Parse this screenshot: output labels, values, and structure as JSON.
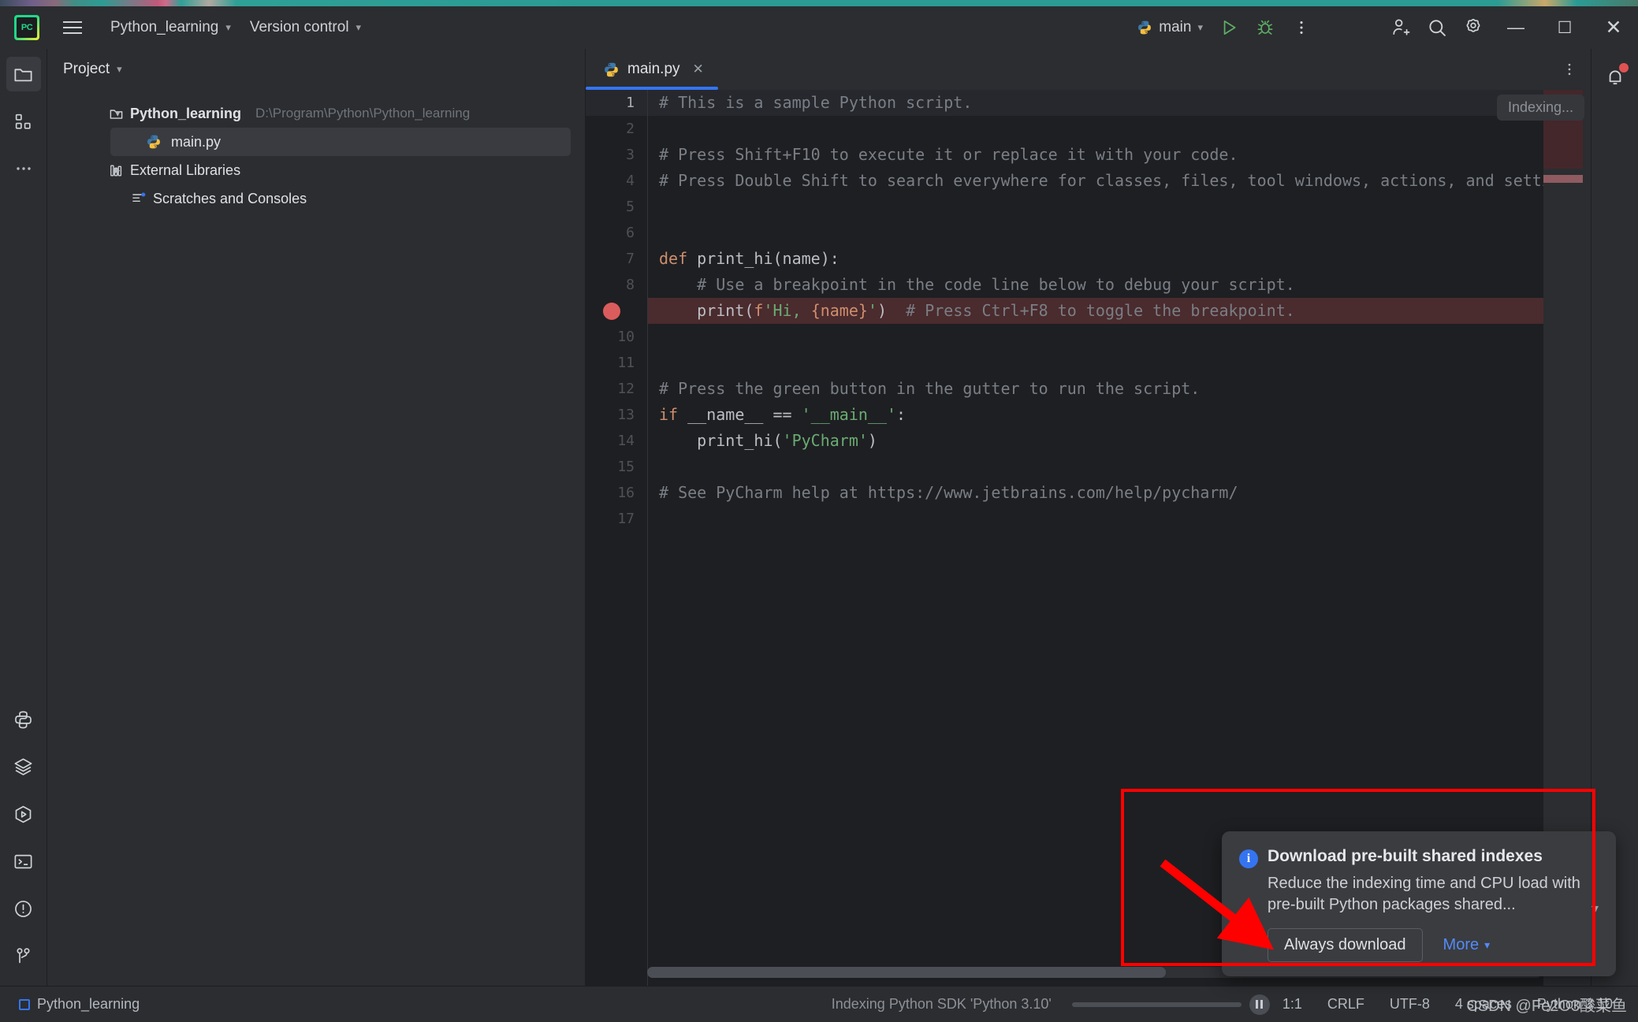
{
  "titlebar": {
    "logo": "pycharm-logo",
    "project_menu": "Python_learning",
    "vcs_menu": "Version control",
    "run_config": "main",
    "icons": [
      "run-icon",
      "debug-icon",
      "more-actions-icon",
      "add-user-icon",
      "search-icon",
      "settings-icon"
    ],
    "window": {
      "minimize": "—",
      "maximize": "☐",
      "close": "✕"
    }
  },
  "leftbar": {
    "top_items": [
      {
        "name": "project-tool-window",
        "icon": "folder-icon",
        "active": true
      },
      {
        "name": "structure-tool-window",
        "icon": "structure-icon",
        "active": false
      },
      {
        "name": "more-tool-windows",
        "icon": "ellipsis-icon",
        "active": false
      }
    ],
    "bottom_items": [
      {
        "name": "python-console",
        "icon": "python-icon"
      },
      {
        "name": "database",
        "icon": "layers-icon"
      },
      {
        "name": "run-tool-window",
        "icon": "run-hex-icon"
      },
      {
        "name": "terminal",
        "icon": "terminal-icon"
      },
      {
        "name": "problems",
        "icon": "warning-circle-icon"
      },
      {
        "name": "version-control",
        "icon": "git-branch-icon"
      }
    ]
  },
  "project": {
    "title": "Project",
    "tree": [
      {
        "label": "Python_learning",
        "path": "D:\\Program\\Python\\Python_learning",
        "icon": "folder-icon",
        "expanded": true,
        "level": 1,
        "selected": false
      },
      {
        "label": "main.py",
        "path": "",
        "icon": "python-file-icon",
        "expanded": null,
        "level": 2,
        "selected": true
      },
      {
        "label": "External Libraries",
        "path": "",
        "icon": "library-icon",
        "expanded": false,
        "level": 1,
        "selected": false
      },
      {
        "label": "Scratches and Consoles",
        "path": "",
        "icon": "scratches-icon",
        "expanded": null,
        "level": 1,
        "selected": false
      }
    ]
  },
  "editor": {
    "tab": {
      "label": "main.py",
      "icon": "python-file-icon",
      "close": "✕"
    },
    "options_icon": "more-vertical-icon",
    "indexing_badge": "Indexing...",
    "breakpoint_line": 9,
    "lines": [
      {
        "n": 1,
        "tokens": [
          {
            "t": "# This is a sample Python script.",
            "c": "cmt"
          }
        ]
      },
      {
        "n": 2,
        "tokens": []
      },
      {
        "n": 3,
        "tokens": [
          {
            "t": "# Press Shift+F10 to execute it or replace it with your code.",
            "c": "cmt"
          }
        ]
      },
      {
        "n": 4,
        "tokens": [
          {
            "t": "# Press Double Shift to search everywhere for classes, files, tool windows, actions, and settings.",
            "c": "cmt"
          }
        ]
      },
      {
        "n": 5,
        "tokens": []
      },
      {
        "n": 6,
        "tokens": []
      },
      {
        "n": 7,
        "tokens": [
          {
            "t": "def ",
            "c": "kw"
          },
          {
            "t": "print_hi(name):",
            "c": "fn"
          }
        ]
      },
      {
        "n": 8,
        "tokens": [
          {
            "t": "    # Use a breakpoint in the code line below to debug your script.",
            "c": "cmt"
          }
        ]
      },
      {
        "n": 9,
        "tokens": [
          {
            "t": "    print(",
            "c": "fn"
          },
          {
            "t": "f",
            "c": "fprefix"
          },
          {
            "t": "'Hi, ",
            "c": "str"
          },
          {
            "t": "{name}",
            "c": "brace"
          },
          {
            "t": "'",
            "c": "str"
          },
          {
            "t": ")  ",
            "c": "fn"
          },
          {
            "t": "# Press Ctrl+F8 to toggle the breakpoint.",
            "c": "cmt"
          }
        ]
      },
      {
        "n": 10,
        "tokens": []
      },
      {
        "n": 11,
        "tokens": []
      },
      {
        "n": 12,
        "tokens": [
          {
            "t": "# Press the green button in the gutter to run the script.",
            "c": "cmt"
          }
        ]
      },
      {
        "n": 13,
        "tokens": [
          {
            "t": "if ",
            "c": "kw"
          },
          {
            "t": "__name__ == ",
            "c": "fn"
          },
          {
            "t": "'__main__'",
            "c": "str"
          },
          {
            "t": ":",
            "c": "fn"
          }
        ]
      },
      {
        "n": 14,
        "tokens": [
          {
            "t": "    print_hi(",
            "c": "fn"
          },
          {
            "t": "'PyCharm'",
            "c": "str"
          },
          {
            "t": ")",
            "c": "fn"
          }
        ]
      },
      {
        "n": 15,
        "tokens": []
      },
      {
        "n": 16,
        "tokens": [
          {
            "t": "# See PyCharm help at https://www.jetbrains.com/help/pycharm/",
            "c": "cmt"
          }
        ]
      },
      {
        "n": 17,
        "tokens": []
      }
    ]
  },
  "rightbar": {
    "items": [
      {
        "name": "notifications",
        "icon": "bell-icon",
        "badge": true
      }
    ]
  },
  "notification": {
    "icon": "info-icon",
    "title": "Download pre-built shared indexes",
    "body": "Reduce the indexing time and CPU load with pre-built Python packages shared...",
    "collapse_icon": "chevron-down-icon",
    "primary_button": "Always download",
    "more_link": "More",
    "more_chevron": "chevron-down-icon"
  },
  "statusbar": {
    "project": "Python_learning",
    "task": "Indexing Python SDK 'Python 3.10'",
    "pause_icon": "pause-icon",
    "caret": "1:1",
    "line_sep": "CRLF",
    "encoding": "UTF-8",
    "indent": "4 spaces",
    "interpreter": "Python 3.10",
    "watermark": "CSDN @Fe2O3酸菜鱼"
  },
  "colors": {
    "accent": "#3574f0",
    "annotation": "#ff0000",
    "breakpoint": "#db5c5c",
    "comment": "#7a7e85",
    "keyword": "#cf8e6d",
    "string": "#6aab73",
    "bg": "#1e1f22",
    "panel": "#2b2d30"
  }
}
